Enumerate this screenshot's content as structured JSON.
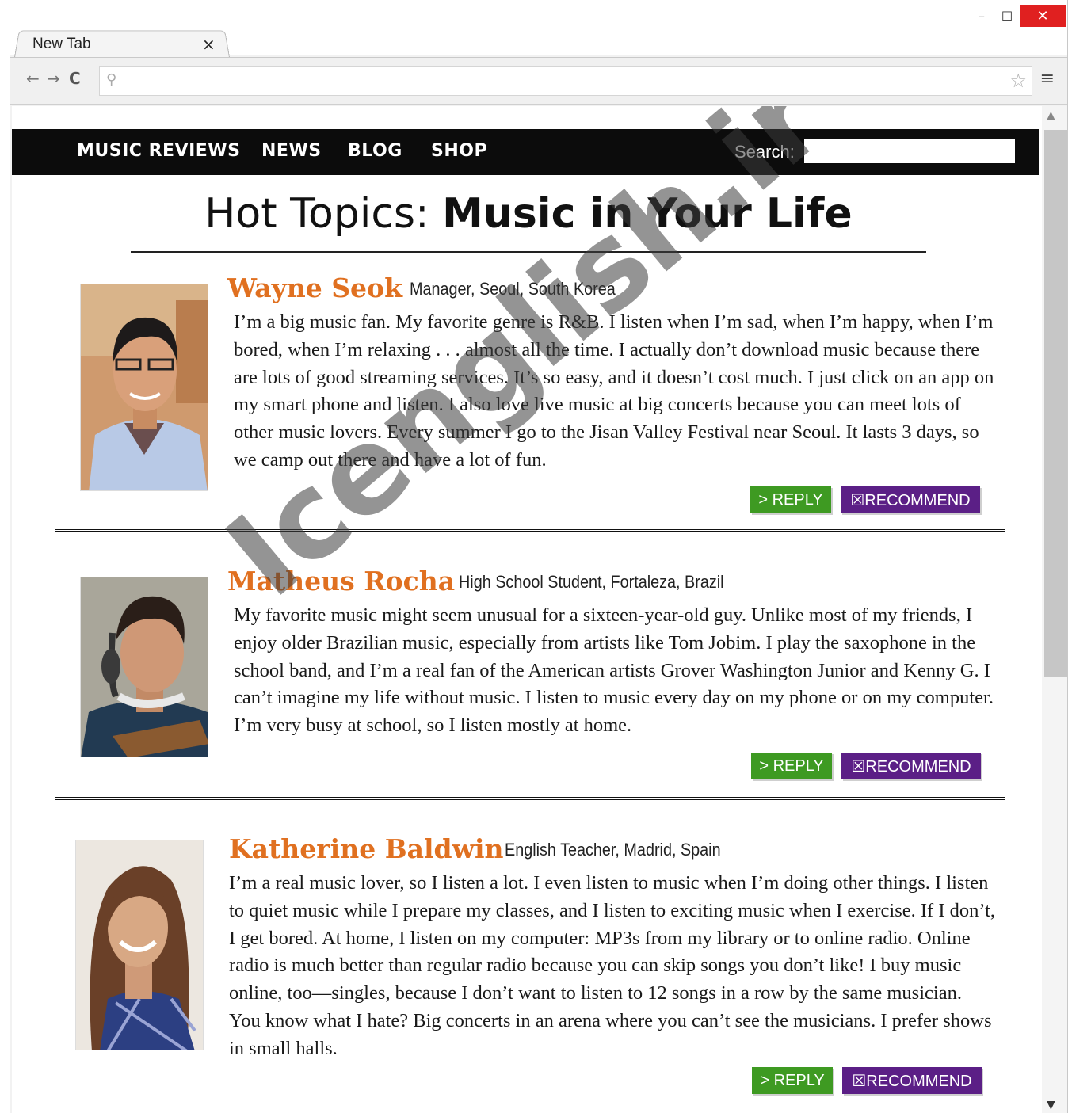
{
  "browser": {
    "tab_title": "New Tab",
    "tab_close": "×",
    "controls": {
      "minimize": "–",
      "maximize": "☐",
      "close": "✕"
    },
    "nav": {
      "back": "←",
      "forward": "→",
      "reload": "C"
    },
    "omnibox": {
      "value": "",
      "search_icon": "⚲",
      "star_icon": "☆"
    },
    "menu_icon": "≡",
    "scroll": {
      "up": "▲",
      "down": "▼"
    }
  },
  "site": {
    "nav_items": [
      "MUSIC REVIEWS",
      "NEWS",
      "BLOG",
      "SHOP"
    ],
    "search_label": "Search:",
    "search_value": ""
  },
  "headline": {
    "prefix": "Hot Topics: ",
    "title": "Music in Your Life"
  },
  "posts": [
    {
      "name": "Wayne Seok",
      "role": "Manager, Seoul, South Korea",
      "body": "I’m a big music fan. My favorite genre is R&B. I listen when I’m sad, when I’m happy, when I’m bored, when I’m relaxing . . . almost all the time. I actually don’t download music because there are lots of good streaming services. It’s so easy, and it doesn’t cost much. I just click on an app on my smart phone and listen. I also love live music at big concerts because you can meet lots of other music lovers. Every summer I go to the Jisan Valley Festival near Seoul. It lasts 3 days, so we camp out there and have a lot of fun.",
      "reply": "> REPLY",
      "recommend": "☒RECOMMEND"
    },
    {
      "name": "Matheus Rocha",
      "role": "High School Student, Fortaleza, Brazil",
      "body": "My favorite music might seem unusual for a sixteen-year-old guy. Unlike most of my friends, I enjoy older Brazilian music, especially from artists like Tom Jobim. I play the saxophone in the school band, and I’m a real fan of the American artists Grover Washington Junior and Kenny G. I can’t imagine my life without music. I listen to music every day on my phone or on my computer. I’m very busy at school, so I listen mostly at home.",
      "reply": "> REPLY",
      "recommend": "☒RECOMMEND"
    },
    {
      "name": "Katherine Baldwin",
      "role": "English Teacher, Madrid, Spain",
      "body": "I’m a real music lover, so I listen a lot. I even listen to music when I’m doing other things. I listen to quiet music while I prepare my classes, and I listen to exciting music when I exercise. If I don’t, I get bored. At home, I listen on my computer: MP3s from my library or to online radio. Online radio is much better than regular radio because you can skip songs you don’t like! I buy music online, too—singles, because I don’t want to listen to 12 songs in a row by the same musician. You know what I hate? Big concerts in an arena where you can’t see the musicians. I prefer shows in small halls.",
      "reply": "> REPLY",
      "recommend": "☒RECOMMEND"
    }
  ],
  "watermark": "Icenglish.ir",
  "colors": {
    "accent_name": "#e07020",
    "reply_green": "#3e9a22",
    "recommend_purple": "#5b1f86",
    "nav_bg": "#0c0c0c",
    "close_red": "#e02020"
  }
}
